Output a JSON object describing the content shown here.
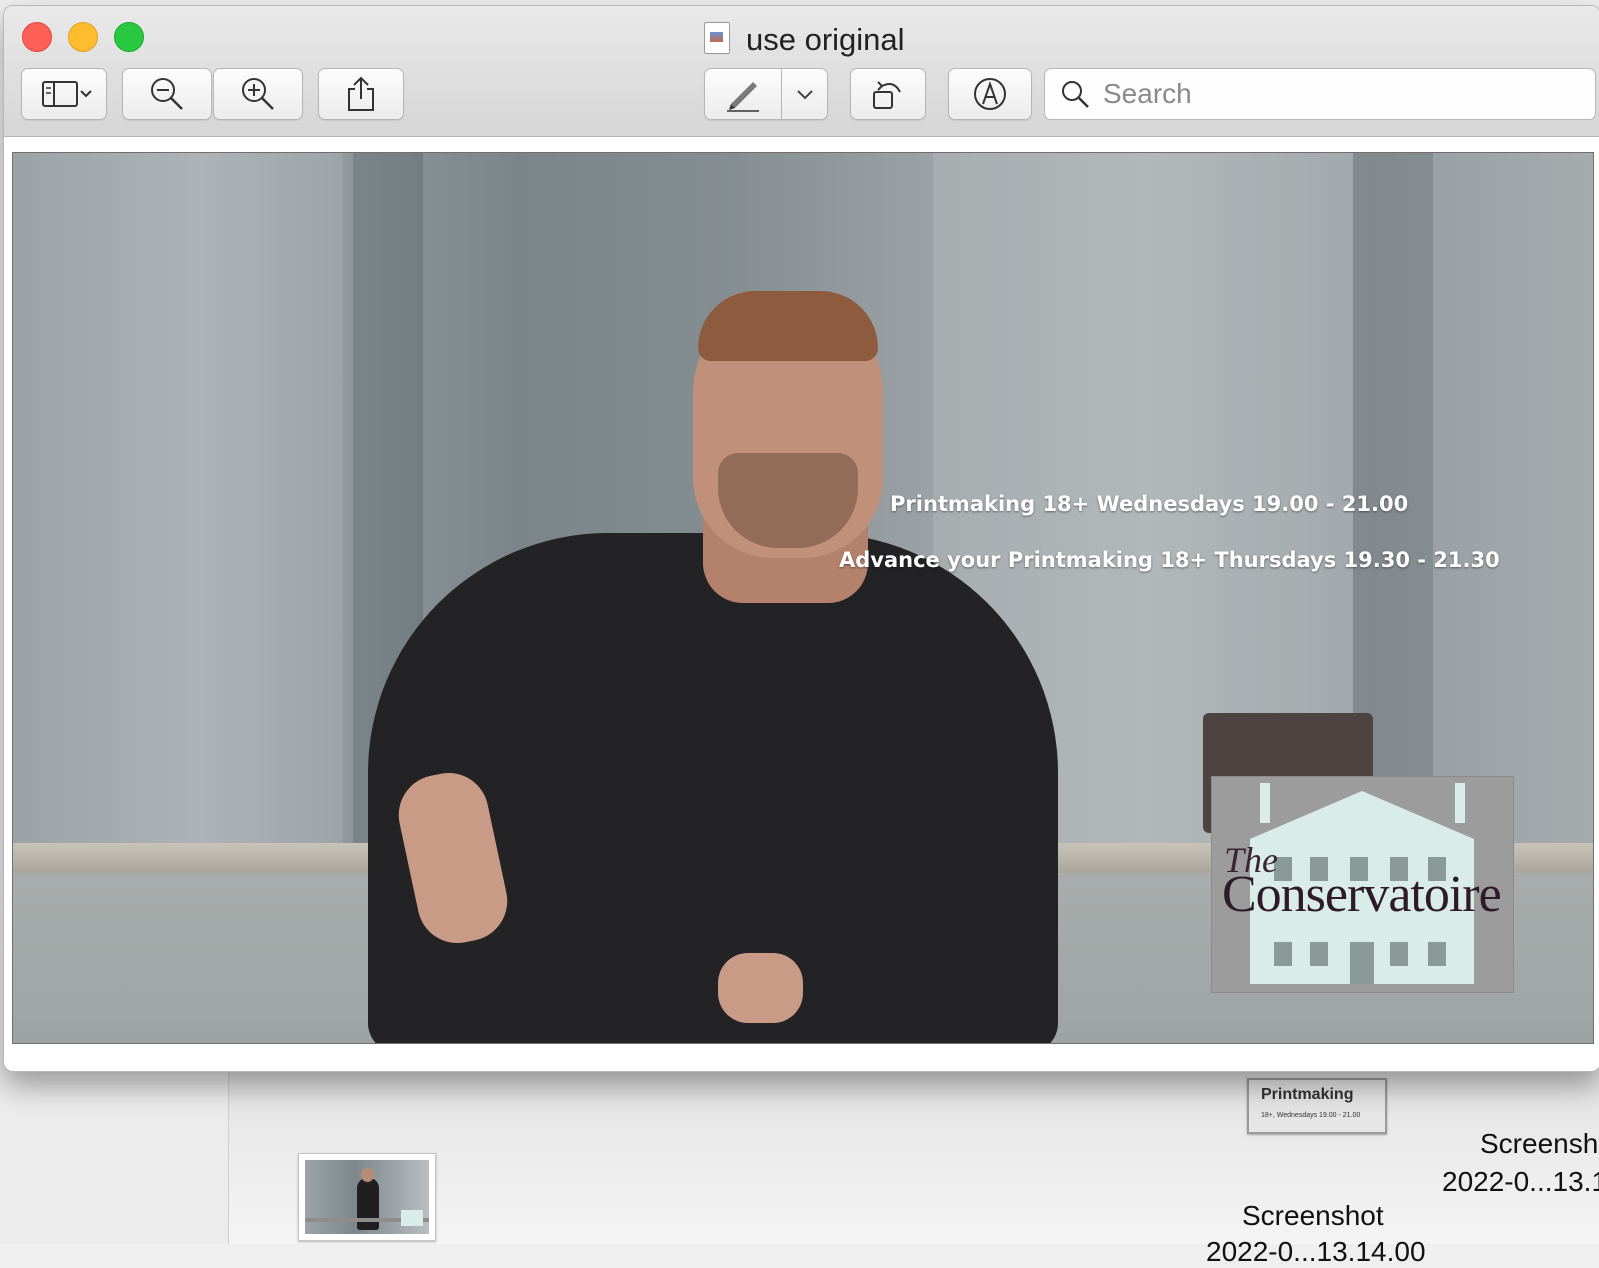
{
  "window": {
    "title": "use original"
  },
  "toolbar": {
    "buttons": [
      {
        "name": "sidebar-toggle",
        "icon": "sidebar-icon"
      },
      {
        "name": "zoom-out",
        "icon": "zoom-out-icon"
      },
      {
        "name": "zoom-in",
        "icon": "zoom-in-icon"
      },
      {
        "name": "share",
        "icon": "share-icon"
      },
      {
        "name": "markup",
        "icon": "pen-icon"
      },
      {
        "name": "rotate",
        "icon": "rotate-icon"
      },
      {
        "name": "annotate",
        "icon": "annotate-icon"
      }
    ]
  },
  "search": {
    "placeholder": "Search",
    "value": ""
  },
  "image": {
    "line1": "Printmaking 18+  Wednesdays  19.00 - 21.00",
    "line2": "Advance your Printmaking 18+  Thursdays 19.30 - 21.30",
    "logo_the": "The",
    "logo_name": "Conservatoire"
  },
  "finder": {
    "mini_doc_title": "Printmaking",
    "mini_doc_sub": "18+, Wednesdays 19.00 - 21.00",
    "file1_line1": "Screensh",
    "file1_line2": "2022-0...13.1",
    "file2_line1": "Screenshot",
    "file2_line2": "2022-0...13.14.00"
  },
  "colors": {
    "close": "#fe5f57",
    "minimize": "#febc2e",
    "zoom": "#28c840",
    "logo_building": "#d9ece8"
  }
}
